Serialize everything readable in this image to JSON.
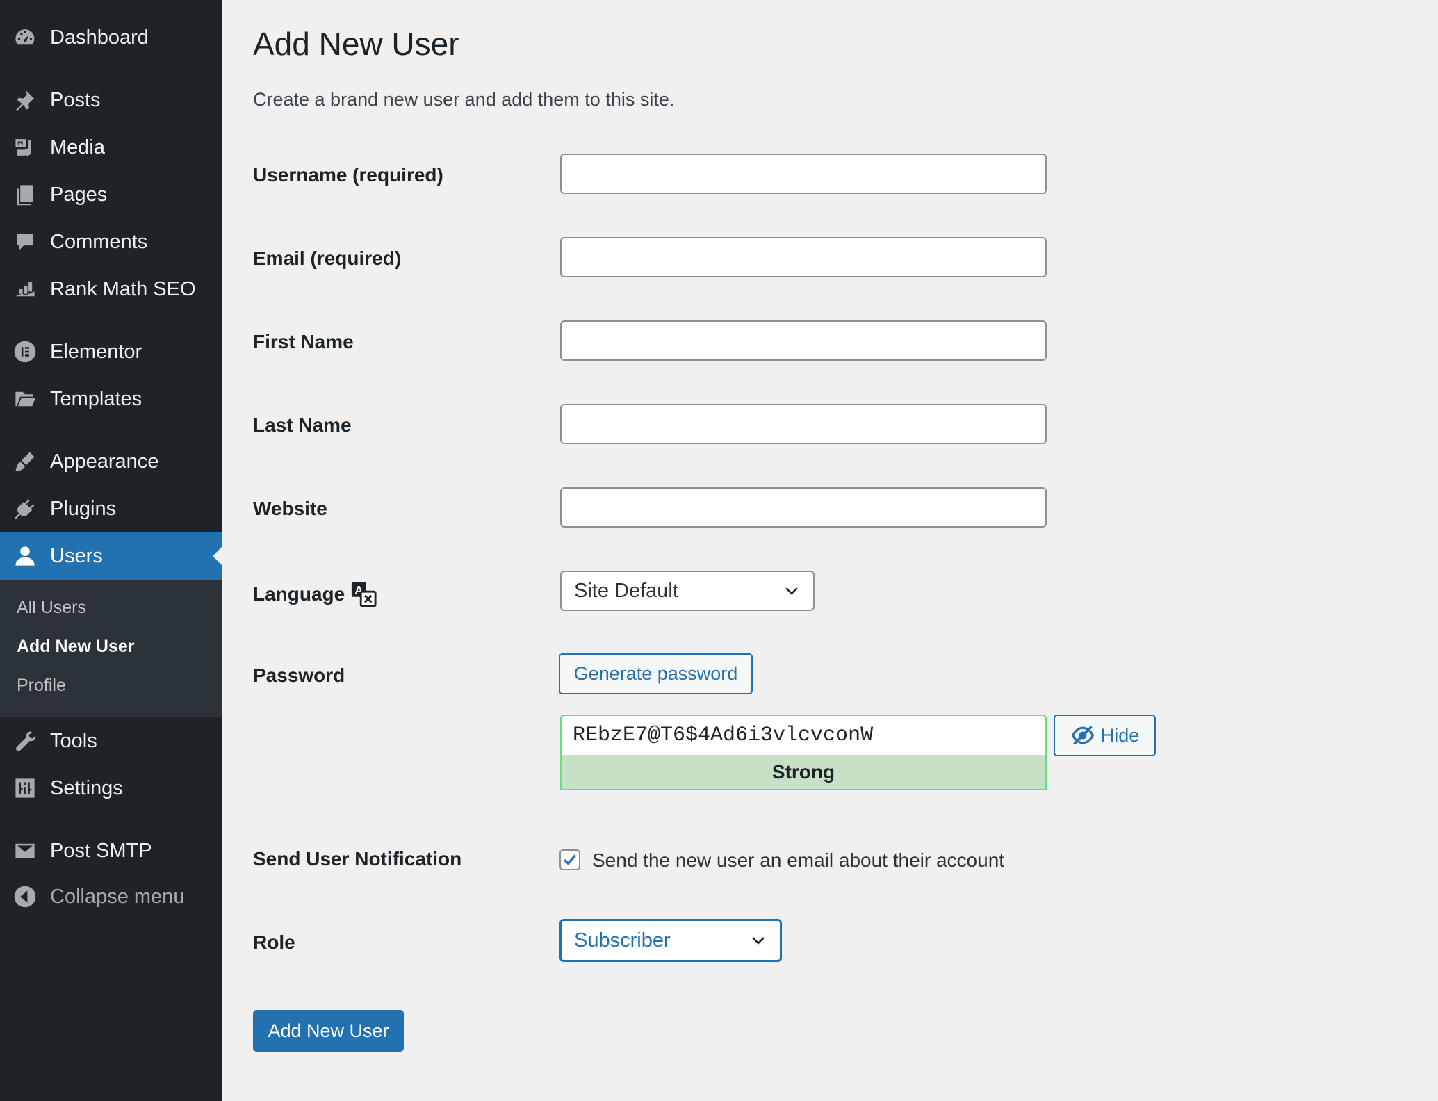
{
  "sidebar": {
    "items": [
      {
        "label": "Dashboard",
        "icon": "dashboard-icon"
      },
      {
        "label": "Posts",
        "icon": "pushpin-icon"
      },
      {
        "label": "Media",
        "icon": "media-icon"
      },
      {
        "label": "Pages",
        "icon": "pages-icon"
      },
      {
        "label": "Comments",
        "icon": "comment-icon"
      },
      {
        "label": "Rank Math SEO",
        "icon": "chart-icon"
      },
      {
        "label": "Elementor",
        "icon": "elementor-icon"
      },
      {
        "label": "Templates",
        "icon": "folder-icon"
      },
      {
        "label": "Appearance",
        "icon": "paintbrush-icon"
      },
      {
        "label": "Plugins",
        "icon": "plug-icon"
      },
      {
        "label": "Users",
        "icon": "user-icon"
      },
      {
        "label": "Tools",
        "icon": "wrench-icon"
      },
      {
        "label": "Settings",
        "icon": "settings-icon"
      },
      {
        "label": "Post SMTP",
        "icon": "envelope-icon"
      },
      {
        "label": "Collapse menu",
        "icon": "collapse-icon"
      }
    ],
    "submenu": [
      "All Users",
      "Add New User",
      "Profile"
    ],
    "active_color": "#2271b1"
  },
  "page": {
    "title": "Add New User",
    "subtitle": "Create a brand new user and add them to this site."
  },
  "form": {
    "username_label": "Username (required)",
    "email_label": "Email (required)",
    "first_name_label": "First Name",
    "last_name_label": "Last Name",
    "website_label": "Website",
    "language_label": "Language",
    "language_value": "Site Default",
    "password_label": "Password",
    "generate_password": "Generate password",
    "password_value": "REbzE7@T6$4Ad6i3vlcvconW",
    "hide_label": "Hide",
    "strength": "Strong",
    "notification_label": "Send User Notification",
    "notification_text": "Send the new user an email about their account",
    "notification_checked": true,
    "role_label": "Role",
    "role_value": "Subscriber",
    "submit": "Add New User"
  }
}
